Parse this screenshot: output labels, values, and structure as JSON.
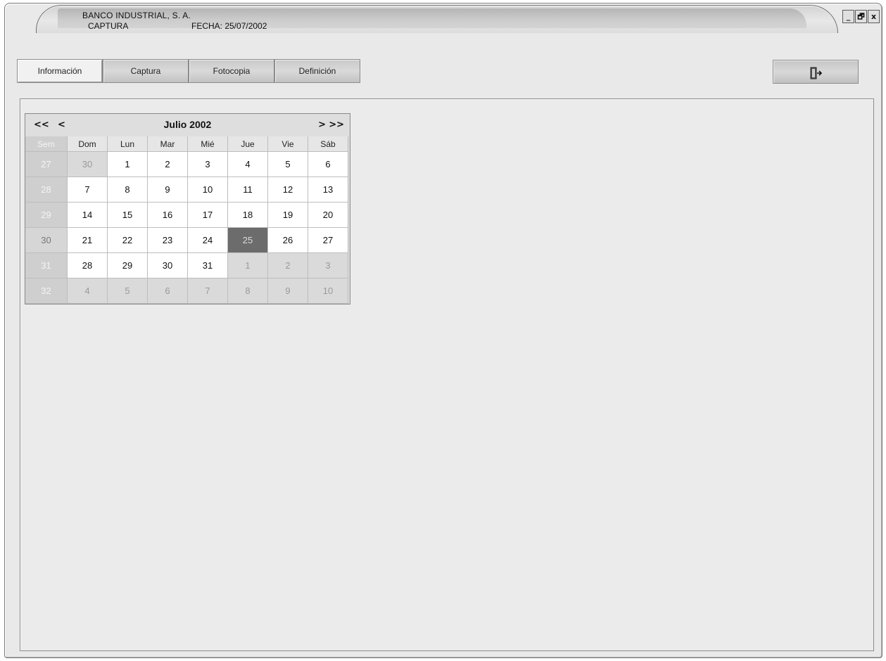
{
  "window": {
    "title": "BANCO INDUSTRIAL, S. A.",
    "subtitle": "CAPTURA",
    "date_label": "FECHA: 25/07/2002",
    "controls": [
      "_",
      "□",
      "x"
    ]
  },
  "toolbar": {
    "tabs": [
      {
        "label": "Información",
        "active": true
      },
      {
        "label": "Captura",
        "active": false
      },
      {
        "label": "Fotocopia",
        "active": false
      },
      {
        "label": "Definición",
        "active": false
      }
    ],
    "exit_icon": "exit-door-icon"
  },
  "calendar": {
    "prev_year": "<<",
    "prev_month": "<",
    "next_month": ">",
    "next_year": ">>",
    "month_label": "Julio 2002",
    "week_header": "Sem",
    "day_headers": [
      "Dom",
      "Lun",
      "Mar",
      "Mié",
      "Jue",
      "Vie",
      "Sáb"
    ],
    "weeks": [
      {
        "week": "27",
        "days": [
          "30",
          "1",
          "2",
          "3",
          "4",
          "5",
          "6"
        ]
      },
      {
        "week": "28",
        "days": [
          "7",
          "8",
          "9",
          "10",
          "11",
          "12",
          "13"
        ]
      },
      {
        "week": "29",
        "days": [
          "14",
          "15",
          "16",
          "17",
          "18",
          "19",
          "20"
        ]
      },
      {
        "week": "30",
        "days": [
          "21",
          "22",
          "23",
          "24",
          "25",
          "26",
          "27"
        ]
      },
      {
        "week": "31",
        "days": [
          "28",
          "29",
          "30",
          "31",
          "1",
          "2",
          "3"
        ]
      },
      {
        "week": "32",
        "days": [
          "4",
          "5",
          "6",
          "7",
          "8",
          "9",
          "10"
        ]
      }
    ],
    "selected_day": "25"
  }
}
